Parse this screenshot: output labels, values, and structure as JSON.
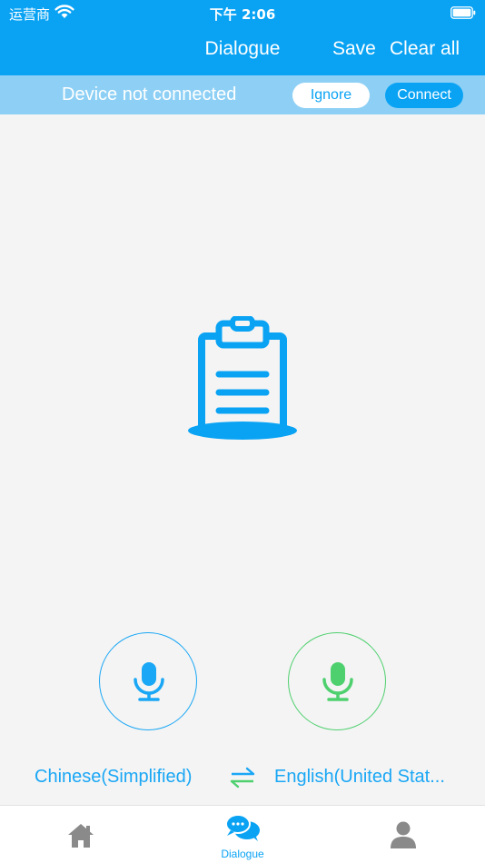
{
  "status_bar": {
    "carrier": "运营商",
    "time": "下午 2:06"
  },
  "nav": {
    "title": "Dialogue",
    "save_label": "Save",
    "clear_label": "Clear all"
  },
  "banner": {
    "message": "Device not connected",
    "ignore_label": "Ignore",
    "connect_label": "Connect"
  },
  "empty_state": {
    "icon": "clipboard-icon"
  },
  "languages": {
    "source": "Chinese(Simplified)",
    "target": "English(United Stat..."
  },
  "tabbar": {
    "items": [
      {
        "icon": "home-icon",
        "label": ""
      },
      {
        "icon": "chat-bubbles-icon",
        "label": "Dialogue",
        "active": true
      },
      {
        "icon": "person-icon",
        "label": ""
      }
    ]
  },
  "colors": {
    "accent": "#0aa3f4",
    "banner": "#8ed0f5",
    "source_mic": "#1aa7f5",
    "target_mic": "#4fd06f",
    "inactive_tab": "#8a8a8a"
  }
}
